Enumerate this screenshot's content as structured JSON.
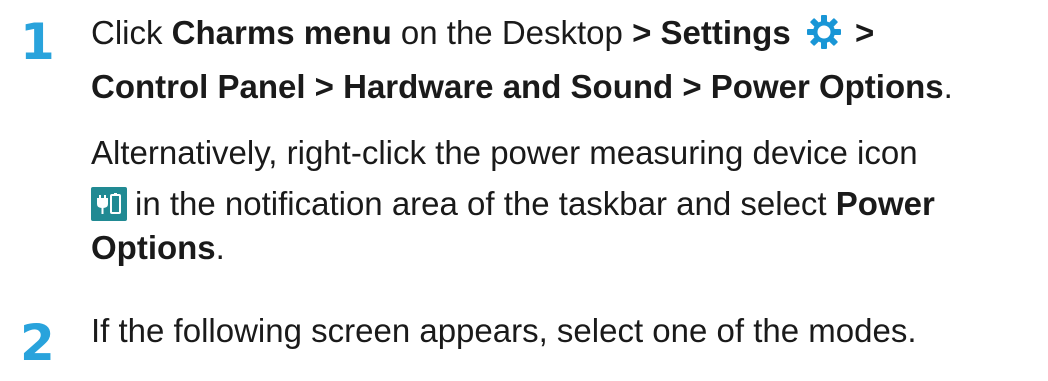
{
  "colors": {
    "step_number": "#29a3dc",
    "gear_icon": "#1996d6",
    "tray_icon_bg": "#218a93"
  },
  "step1": {
    "number": "1",
    "line1": {
      "click": "Click",
      "charms_menu": "Charms menu",
      "on_desktop": "on the Desktop",
      "sep": ">",
      "settings": "Settings",
      "trailing_sep": ">"
    },
    "line2": {
      "path": "Control Panel > Hardware and Sound > Power Options",
      "period": "."
    },
    "alt_line1": "Alternatively, right-click the power measuring device icon",
    "alt_line2_text": "in the notification area of the taskbar and select",
    "alt_bold_power": "Power",
    "alt_bold_options": "Options",
    "alt_period": ".",
    "icons": {
      "settings": "gear-icon",
      "tray": "power-measuring-device-icon"
    }
  },
  "step2": {
    "number": "2",
    "text": "If the following screen appears, select one of the modes."
  }
}
